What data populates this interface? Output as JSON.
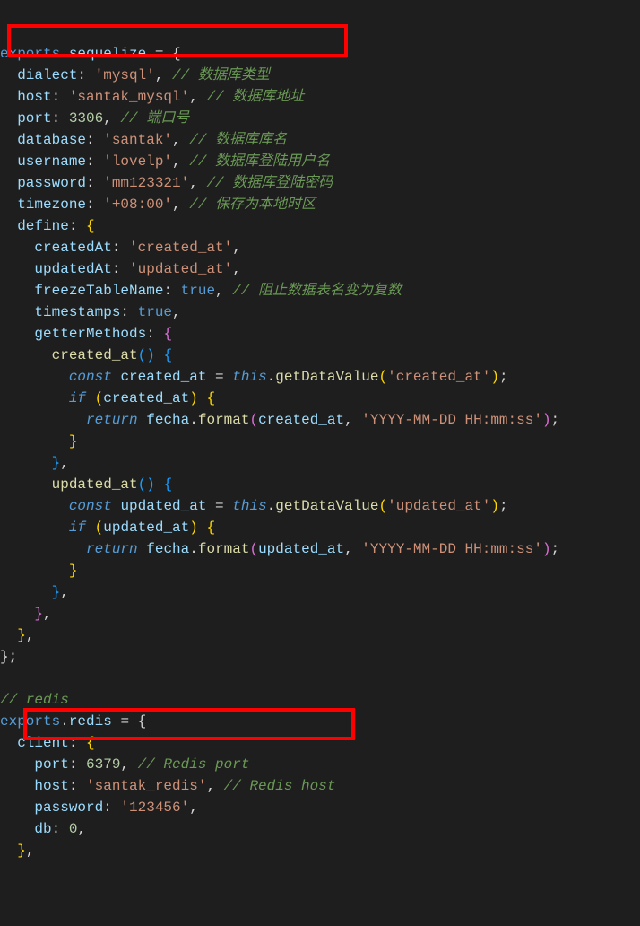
{
  "lines": [
    {
      "i": 0,
      "segs": [
        [
          "c-export",
          "exports"
        ],
        [
          "c-punct",
          "."
        ],
        [
          "c-prop",
          "sequelize"
        ],
        [
          "c-punct",
          " = {"
        ]
      ]
    },
    {
      "i": 1,
      "segs": [
        [
          "c-prop",
          "dialect"
        ],
        [
          "c-colon",
          ": "
        ],
        [
          "c-string",
          "'mysql'"
        ],
        [
          "c-punct",
          ", "
        ],
        [
          "c-comment",
          "// 数据库类型"
        ]
      ]
    },
    {
      "i": 1,
      "segs": [
        [
          "c-prop",
          "host"
        ],
        [
          "c-colon",
          ": "
        ],
        [
          "c-string",
          "'santak_mysql'"
        ],
        [
          "c-punct",
          ", "
        ],
        [
          "c-comment",
          "// 数据库地址"
        ]
      ]
    },
    {
      "i": 1,
      "segs": [
        [
          "c-prop",
          "port"
        ],
        [
          "c-colon",
          ": "
        ],
        [
          "c-num",
          "3306"
        ],
        [
          "c-punct",
          ", "
        ],
        [
          "c-comment",
          "// 端口号"
        ]
      ]
    },
    {
      "i": 1,
      "segs": [
        [
          "c-prop",
          "database"
        ],
        [
          "c-colon",
          ": "
        ],
        [
          "c-string",
          "'santak'"
        ],
        [
          "c-punct",
          ", "
        ],
        [
          "c-comment",
          "// 数据库库名"
        ]
      ]
    },
    {
      "i": 1,
      "segs": [
        [
          "c-prop",
          "username"
        ],
        [
          "c-colon",
          ": "
        ],
        [
          "c-string",
          "'lovelp'"
        ],
        [
          "c-punct",
          ", "
        ],
        [
          "c-comment",
          "// 数据库登陆用户名"
        ]
      ]
    },
    {
      "i": 1,
      "segs": [
        [
          "c-prop",
          "password"
        ],
        [
          "c-colon",
          ": "
        ],
        [
          "c-string",
          "'mm123321'"
        ],
        [
          "c-punct",
          ", "
        ],
        [
          "c-comment",
          "// 数据库登陆密码"
        ]
      ]
    },
    {
      "i": 1,
      "segs": [
        [
          "c-prop",
          "timezone"
        ],
        [
          "c-colon",
          ": "
        ],
        [
          "c-string",
          "'+08:00'"
        ],
        [
          "c-punct",
          ", "
        ],
        [
          "c-comment",
          "// 保存为本地时区"
        ]
      ]
    },
    {
      "i": 1,
      "segs": [
        [
          "c-prop",
          "define"
        ],
        [
          "c-colon",
          ": "
        ],
        [
          "c-brace",
          "{"
        ]
      ]
    },
    {
      "i": 2,
      "segs": [
        [
          "c-prop",
          "createdAt"
        ],
        [
          "c-colon",
          ": "
        ],
        [
          "c-string",
          "'created_at'"
        ],
        [
          "c-punct",
          ","
        ]
      ]
    },
    {
      "i": 2,
      "segs": [
        [
          "c-prop",
          "updatedAt"
        ],
        [
          "c-colon",
          ": "
        ],
        [
          "c-string",
          "'updated_at'"
        ],
        [
          "c-punct",
          ","
        ]
      ]
    },
    {
      "i": 2,
      "segs": [
        [
          "c-prop",
          "freezeTableName"
        ],
        [
          "c-colon",
          ": "
        ],
        [
          "c-bool",
          "true"
        ],
        [
          "c-punct",
          ", "
        ],
        [
          "c-comment",
          "// 阻止数据表名变为复数"
        ]
      ]
    },
    {
      "i": 2,
      "segs": [
        [
          "c-prop",
          "timestamps"
        ],
        [
          "c-colon",
          ": "
        ],
        [
          "c-bool",
          "true"
        ],
        [
          "c-punct",
          ","
        ]
      ]
    },
    {
      "i": 2,
      "segs": [
        [
          "c-prop",
          "getterMethods"
        ],
        [
          "c-colon",
          ": "
        ],
        [
          "c-brace2",
          "{"
        ]
      ]
    },
    {
      "i": 3,
      "segs": [
        [
          "c-funcname",
          "created_at"
        ],
        [
          "c-brace3",
          "()"
        ],
        [
          "c-punct",
          " "
        ],
        [
          "c-brace3",
          "{"
        ]
      ]
    },
    {
      "i": 4,
      "segs": [
        [
          "c-keyword",
          "const"
        ],
        [
          "c-punct",
          " "
        ],
        [
          "c-prop",
          "created_at"
        ],
        [
          "c-punct",
          " = "
        ],
        [
          "c-this",
          "this"
        ],
        [
          "c-punct",
          "."
        ],
        [
          "c-method",
          "getDataValue"
        ],
        [
          "c-brace",
          "("
        ],
        [
          "c-string",
          "'created_at'"
        ],
        [
          "c-brace",
          ")"
        ],
        [
          "c-punct",
          ";"
        ]
      ]
    },
    {
      "i": 4,
      "segs": [
        [
          "c-keyword",
          "if"
        ],
        [
          "c-punct",
          " "
        ],
        [
          "c-brace",
          "("
        ],
        [
          "c-prop",
          "created_at"
        ],
        [
          "c-brace",
          ")"
        ],
        [
          "c-punct",
          " "
        ],
        [
          "c-brace",
          "{"
        ]
      ]
    },
    {
      "i": 5,
      "segs": [
        [
          "c-keyword",
          "return"
        ],
        [
          "c-punct",
          " "
        ],
        [
          "c-prop",
          "fecha"
        ],
        [
          "c-punct",
          "."
        ],
        [
          "c-method",
          "format"
        ],
        [
          "c-brace2",
          "("
        ],
        [
          "c-prop",
          "created_at"
        ],
        [
          "c-punct",
          ", "
        ],
        [
          "c-string",
          "'YYYY-MM-DD HH:mm:ss'"
        ],
        [
          "c-brace2",
          ")"
        ],
        [
          "c-punct",
          ";"
        ]
      ]
    },
    {
      "i": 4,
      "segs": [
        [
          "c-brace",
          "}"
        ]
      ]
    },
    {
      "i": 3,
      "segs": [
        [
          "c-brace3",
          "}"
        ],
        [
          "c-punct",
          ","
        ]
      ]
    },
    {
      "i": 3,
      "segs": [
        [
          "c-funcname",
          "updated_at"
        ],
        [
          "c-brace3",
          "()"
        ],
        [
          "c-punct",
          " "
        ],
        [
          "c-brace3",
          "{"
        ]
      ]
    },
    {
      "i": 4,
      "segs": [
        [
          "c-keyword",
          "const"
        ],
        [
          "c-punct",
          " "
        ],
        [
          "c-prop",
          "updated_at"
        ],
        [
          "c-punct",
          " = "
        ],
        [
          "c-this",
          "this"
        ],
        [
          "c-punct",
          "."
        ],
        [
          "c-method",
          "getDataValue"
        ],
        [
          "c-brace",
          "("
        ],
        [
          "c-string",
          "'updated_at'"
        ],
        [
          "c-brace",
          ")"
        ],
        [
          "c-punct",
          ";"
        ]
      ]
    },
    {
      "i": 4,
      "segs": [
        [
          "c-keyword",
          "if"
        ],
        [
          "c-punct",
          " "
        ],
        [
          "c-brace",
          "("
        ],
        [
          "c-prop",
          "updated_at"
        ],
        [
          "c-brace",
          ")"
        ],
        [
          "c-punct",
          " "
        ],
        [
          "c-brace",
          "{"
        ]
      ]
    },
    {
      "i": 5,
      "segs": [
        [
          "c-keyword",
          "return"
        ],
        [
          "c-punct",
          " "
        ],
        [
          "c-prop",
          "fecha"
        ],
        [
          "c-punct",
          "."
        ],
        [
          "c-method",
          "format"
        ],
        [
          "c-brace2",
          "("
        ],
        [
          "c-prop",
          "updated_at"
        ],
        [
          "c-punct",
          ", "
        ],
        [
          "c-string",
          "'YYYY-MM-DD HH:mm:ss'"
        ],
        [
          "c-brace2",
          ")"
        ],
        [
          "c-punct",
          ";"
        ]
      ]
    },
    {
      "i": 4,
      "segs": [
        [
          "c-brace",
          "}"
        ]
      ]
    },
    {
      "i": 3,
      "segs": [
        [
          "c-brace3",
          "}"
        ],
        [
          "c-punct",
          ","
        ]
      ]
    },
    {
      "i": 2,
      "segs": [
        [
          "c-brace2",
          "}"
        ],
        [
          "c-punct",
          ","
        ]
      ]
    },
    {
      "i": 1,
      "segs": [
        [
          "c-brace",
          "}"
        ],
        [
          "c-punct",
          ","
        ]
      ]
    },
    {
      "i": 0,
      "segs": [
        [
          "c-punct",
          "};"
        ]
      ]
    },
    {
      "i": 0,
      "segs": [
        [
          "",
          ""
        ]
      ]
    },
    {
      "i": 0,
      "segs": [
        [
          "c-comment",
          "// redis"
        ]
      ]
    },
    {
      "i": 0,
      "segs": [
        [
          "c-export",
          "exports"
        ],
        [
          "c-punct",
          "."
        ],
        [
          "c-prop",
          "redis"
        ],
        [
          "c-punct",
          " = {"
        ]
      ]
    },
    {
      "i": 1,
      "segs": [
        [
          "c-prop",
          "client"
        ],
        [
          "c-colon",
          ": "
        ],
        [
          "c-brace",
          "{"
        ]
      ]
    },
    {
      "i": 2,
      "segs": [
        [
          "c-prop",
          "port"
        ],
        [
          "c-colon",
          ": "
        ],
        [
          "c-num",
          "6379"
        ],
        [
          "c-punct",
          ", "
        ],
        [
          "c-comment",
          "// Redis port"
        ]
      ]
    },
    {
      "i": 2,
      "segs": [
        [
          "c-prop",
          "host"
        ],
        [
          "c-colon",
          ": "
        ],
        [
          "c-string",
          "'santak_redis'"
        ],
        [
          "c-punct",
          ", "
        ],
        [
          "c-comment",
          "// Redis host"
        ]
      ]
    },
    {
      "i": 2,
      "segs": [
        [
          "c-prop",
          "password"
        ],
        [
          "c-colon",
          ": "
        ],
        [
          "c-string",
          "'123456'"
        ],
        [
          "c-punct",
          ","
        ]
      ]
    },
    {
      "i": 2,
      "segs": [
        [
          "c-prop",
          "db"
        ],
        [
          "c-colon",
          ": "
        ],
        [
          "c-num",
          "0"
        ],
        [
          "c-punct",
          ","
        ]
      ]
    },
    {
      "i": 1,
      "segs": [
        [
          "c-brace",
          "}"
        ],
        [
          "c-punct",
          ","
        ]
      ]
    }
  ],
  "indent_unit": "  ",
  "highlights": [
    {
      "id": "box1"
    },
    {
      "id": "box2"
    }
  ]
}
